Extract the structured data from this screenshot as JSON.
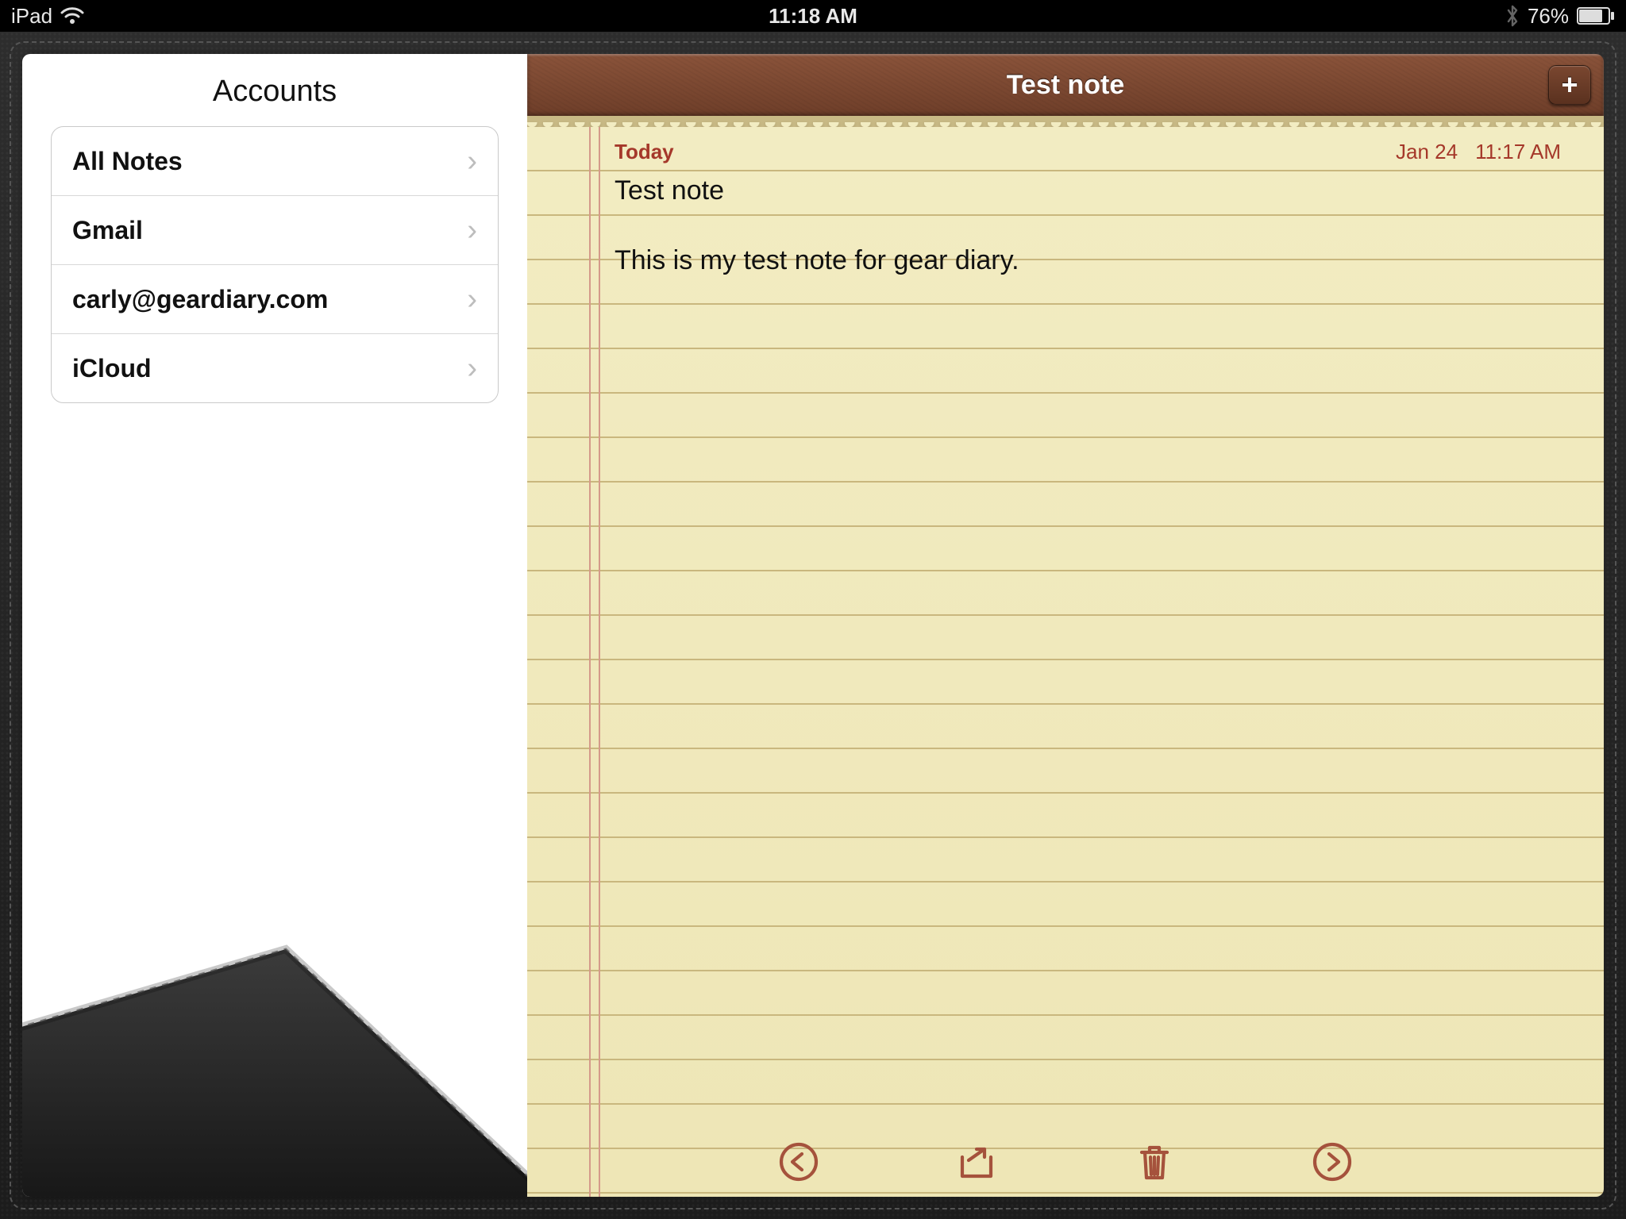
{
  "status": {
    "device": "iPad",
    "time": "11:18 AM",
    "battery_pct": "76%"
  },
  "sidebar": {
    "title": "Accounts",
    "items": [
      {
        "label": "All Notes"
      },
      {
        "label": "Gmail"
      },
      {
        "label": "carly@geardiary.com"
      },
      {
        "label": "iCloud"
      }
    ]
  },
  "note": {
    "header_title": "Test note",
    "today_label": "Today",
    "date": "Jan 24",
    "time": "11:17 AM",
    "title_line": "Test note",
    "body_line": "This is my test note for gear diary."
  }
}
